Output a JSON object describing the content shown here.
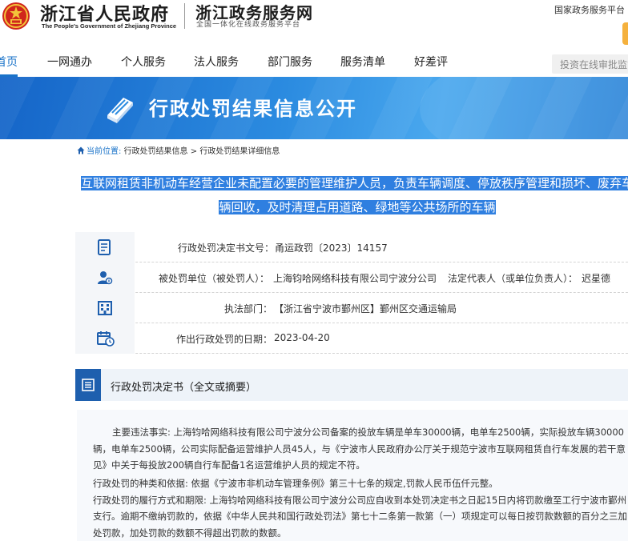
{
  "header": {
    "gov_name": "浙江省人民政府",
    "gov_en": "The People's Government of Zhejiang Province",
    "service_name": "浙江政务服务网",
    "service_subtitle": "全国一体化在线政务服务平台",
    "platform_link": "国家政务服务平台"
  },
  "nav": {
    "items": [
      "首页",
      "一网通办",
      "个人服务",
      "法人服务",
      "部门服务",
      "服务清单",
      "好差评"
    ],
    "active_index": 0,
    "search_placeholder": "投资在线审批监管平台"
  },
  "banner": {
    "title": "行政处罚结果信息公开"
  },
  "breadcrumb": {
    "current_label": "当前位置:",
    "level1": "行政处罚结果信息",
    "sep": ">",
    "level2": "行政处罚结果详细信息"
  },
  "case": {
    "title_line1": "互联网租赁非机动车经营企业未配置必要的管理维护人员，负责车辆调度、停放秩序管理和损坏、废弃车",
    "title_line2": "辆回收，及时清理占用道路、绿地等公共场所的车辆",
    "decision_no_label": "行政处罚决定书文号：",
    "decision_no": "甬运政罚〔2023〕14157",
    "punished_label": "被处罚单位（被处罚人）：",
    "punished": "上海钧哈网络科技有限公司宁波分公司",
    "legal_rep_label": "法定代表人（或单位负责人）：",
    "legal_rep": "迟星德",
    "authority_label": "执法部门：",
    "authority": "【浙江省宁波市鄞州区】鄞州区交通运输局",
    "date_label": "作出行政处罚的日期：",
    "date": "2023-04-20"
  },
  "section": {
    "title": "行政处罚决定书（全文或摘要）"
  },
  "content": {
    "p1": "主要违法事实: 上海钧哈网络科技有限公司宁波分公司备案的投放车辆是单车30000辆，电单车2500辆，实际投放车辆30000辆，电单车2500辆，公司实际配备运营维护人员45人，与《宁波市人民政府办公厅关于规范宁波市互联网租赁自行车发展的若干意见》中关于每投放200辆自行车配备1名运营维护人员的规定不符。",
    "p2": "行政处罚的种类和依据: 依据《宁波市非机动车管理条例》第三十七条的规定,罚款人民币伍仟元整。",
    "p3": "行政处罚的履行方式和期限: 上海钧哈网络科技有限公司宁波分公司应自收到本处罚决定书之日起15日内将罚款缴至工行宁波市鄞州支行。逾期不缴纳罚款的，依据《中华人民共和国行政处罚法》第七十二条第一款第（一）项规定可以每日按罚款数额的百分之三加处罚款，加处罚款的数额不得超出罚款的数额。"
  },
  "colors": {
    "accent": "#1a73c9",
    "banner": "#2b8be0",
    "highlight": "#2f7fe0",
    "section_square": "#1e5fae",
    "emblem_red": "#d0261c",
    "emblem_gold": "#f3c33a"
  }
}
